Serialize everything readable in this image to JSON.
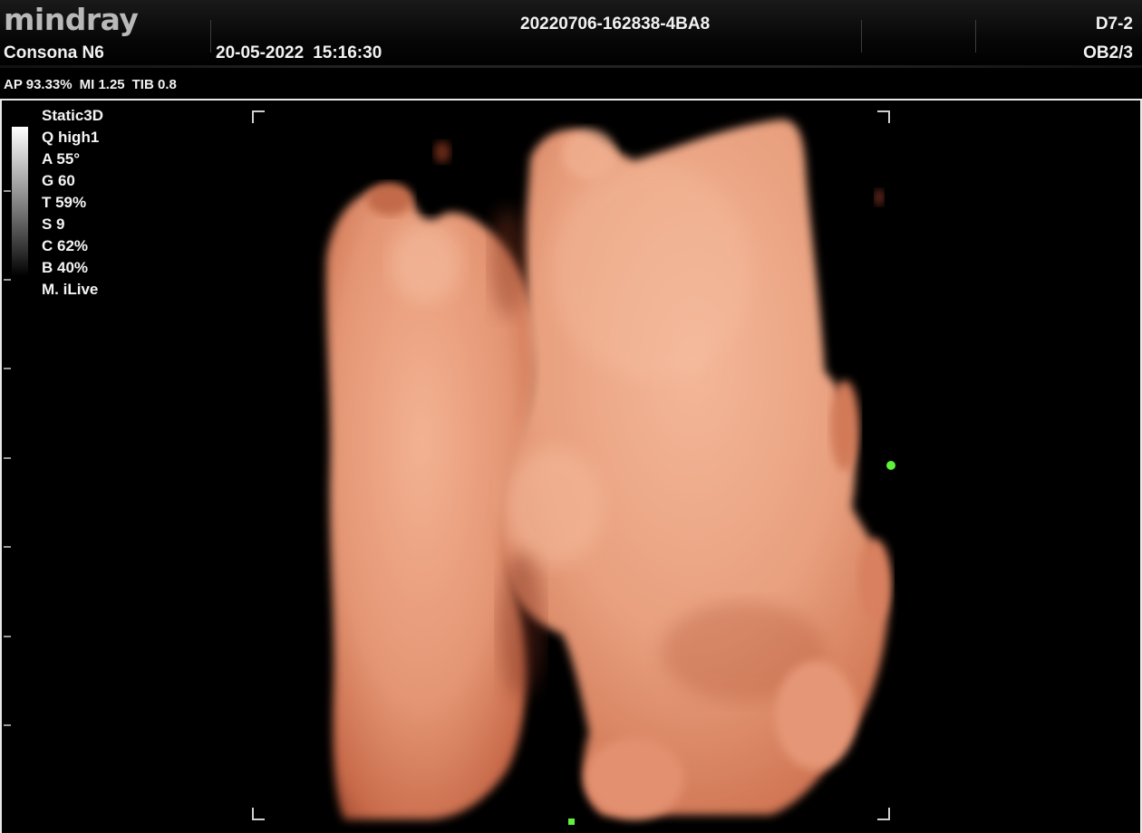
{
  "header": {
    "logo": "mindray",
    "model": "Consona N6",
    "date": "20-05-2022",
    "time": "15:16:30",
    "exam_id": "20220706-162838-4BA8",
    "probe": "D7-2",
    "preset": "OB2/3"
  },
  "power": {
    "ap": "AP 93.33%",
    "mi": "MI 1.25",
    "tib": "TIB 0.8"
  },
  "imaging": {
    "mode": "Static3D",
    "params": [
      "Q high1",
      "A 55°",
      "G 60",
      "T 59%",
      "S 9",
      "C 62%",
      "B 40%",
      "M. iLive"
    ]
  },
  "colors": {
    "background": "#000000",
    "render_tone": "#e89a78",
    "marker": "#5ef23a"
  },
  "icons": {
    "focus_marker": "green-dot",
    "roi_box": "corner-brackets"
  }
}
